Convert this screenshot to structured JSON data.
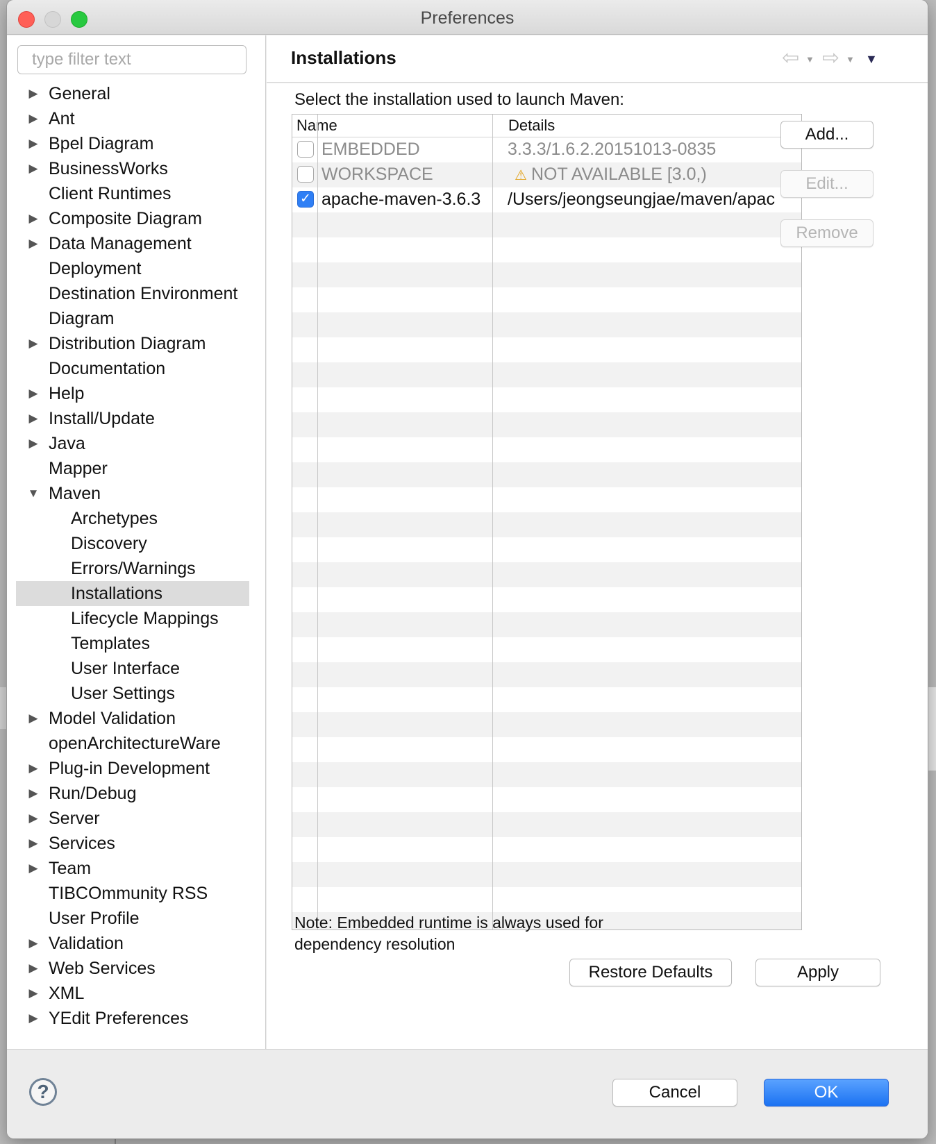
{
  "window": {
    "title": "Preferences"
  },
  "sidebar": {
    "filter_placeholder": "type filter text",
    "items": [
      {
        "label": "General",
        "expandable": true,
        "level": 0
      },
      {
        "label": "Ant",
        "expandable": true,
        "level": 0
      },
      {
        "label": "Bpel Diagram",
        "expandable": true,
        "level": 0
      },
      {
        "label": "BusinessWorks",
        "expandable": true,
        "level": 0
      },
      {
        "label": "Client Runtimes",
        "expandable": false,
        "level": 0
      },
      {
        "label": "Composite Diagram",
        "expandable": true,
        "level": 0
      },
      {
        "label": "Data Management",
        "expandable": true,
        "level": 0
      },
      {
        "label": "Deployment",
        "expandable": false,
        "level": 0
      },
      {
        "label": "Destination Environment",
        "expandable": false,
        "level": 0
      },
      {
        "label": "Diagram",
        "expandable": false,
        "level": 0
      },
      {
        "label": "Distribution Diagram",
        "expandable": true,
        "level": 0
      },
      {
        "label": "Documentation",
        "expandable": false,
        "level": 0
      },
      {
        "label": "Help",
        "expandable": true,
        "level": 0
      },
      {
        "label": "Install/Update",
        "expandable": true,
        "level": 0
      },
      {
        "label": "Java",
        "expandable": true,
        "level": 0
      },
      {
        "label": "Mapper",
        "expandable": false,
        "level": 0
      },
      {
        "label": "Maven",
        "expandable": true,
        "expanded": true,
        "level": 0
      },
      {
        "label": "Archetypes",
        "expandable": false,
        "level": 1
      },
      {
        "label": "Discovery",
        "expandable": false,
        "level": 1
      },
      {
        "label": "Errors/Warnings",
        "expandable": false,
        "level": 1
      },
      {
        "label": "Installations",
        "expandable": false,
        "level": 1,
        "selected": true
      },
      {
        "label": "Lifecycle Mappings",
        "expandable": false,
        "level": 1
      },
      {
        "label": "Templates",
        "expandable": false,
        "level": 1
      },
      {
        "label": "User Interface",
        "expandable": false,
        "level": 1
      },
      {
        "label": "User Settings",
        "expandable": false,
        "level": 1
      },
      {
        "label": "Model Validation",
        "expandable": true,
        "level": 0
      },
      {
        "label": "openArchitectureWare",
        "expandable": false,
        "level": 0
      },
      {
        "label": "Plug-in Development",
        "expandable": true,
        "level": 0
      },
      {
        "label": "Run/Debug",
        "expandable": true,
        "level": 0
      },
      {
        "label": "Server",
        "expandable": true,
        "level": 0
      },
      {
        "label": "Services",
        "expandable": true,
        "level": 0
      },
      {
        "label": "Team",
        "expandable": true,
        "level": 0
      },
      {
        "label": "TIBCOmmunity RSS",
        "expandable": false,
        "level": 0
      },
      {
        "label": "User Profile",
        "expandable": false,
        "level": 0
      },
      {
        "label": "Validation",
        "expandable": true,
        "level": 0
      },
      {
        "label": "Web Services",
        "expandable": true,
        "level": 0
      },
      {
        "label": "XML",
        "expandable": true,
        "level": 0
      },
      {
        "label": "YEdit Preferences",
        "expandable": true,
        "level": 0
      }
    ]
  },
  "page": {
    "title": "Installations",
    "instruction": "Select the installation used to launch Maven:",
    "table": {
      "columns": [
        "Name",
        "Details"
      ],
      "rows": [
        {
          "checked": false,
          "name": "EMBEDDED",
          "details": "3.3.3/1.6.2.20151013-0835",
          "muted": true,
          "warning": false
        },
        {
          "checked": false,
          "name": "WORKSPACE",
          "details": "NOT AVAILABLE [3.0,)",
          "muted": true,
          "warning": true
        },
        {
          "checked": true,
          "name": "apache-maven-3.6.3",
          "details": "/Users/jeongseungjae/maven/apac",
          "muted": false,
          "warning": false
        }
      ],
      "empty_rows": 29
    },
    "side_buttons": {
      "add": "Add...",
      "edit": "Edit...",
      "remove": "Remove"
    },
    "note": "Note: Embedded runtime is always used for dependency resolution",
    "restore_defaults": "Restore Defaults",
    "apply": "Apply"
  },
  "footer": {
    "cancel": "Cancel",
    "ok": "OK"
  },
  "icons": {
    "back": "arrow-left-icon",
    "forward": "arrow-right-icon",
    "menu": "menu-triangle-icon",
    "help": "help-icon",
    "warning": "warning-icon"
  },
  "colors": {
    "accent": "#1b72f2",
    "selection": "#dcdcdc",
    "warning": "#e2a21a"
  }
}
